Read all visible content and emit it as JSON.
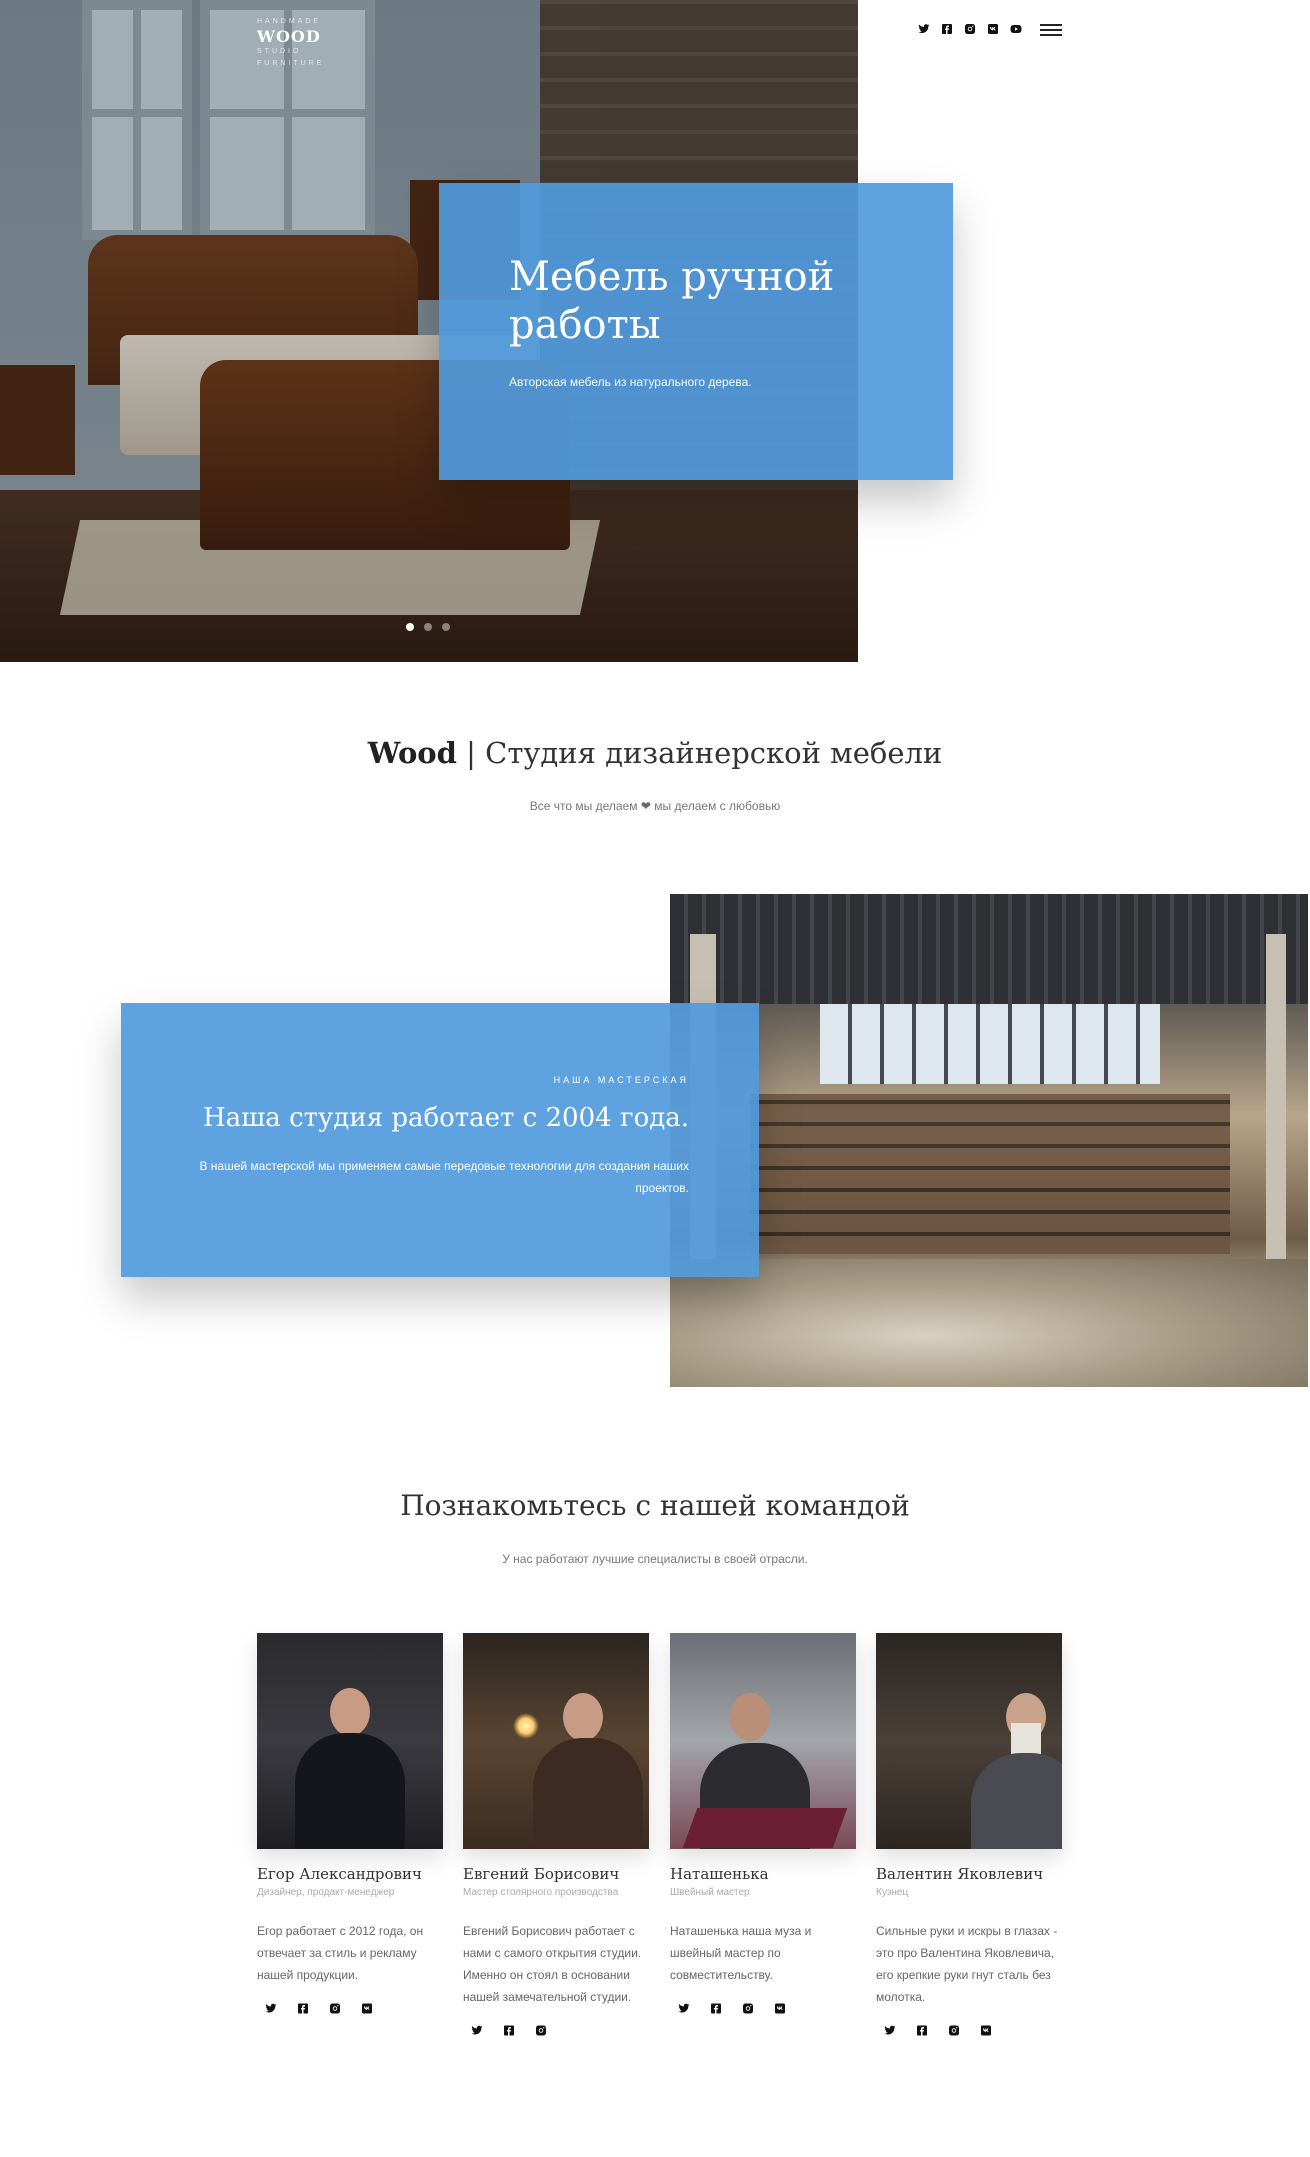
{
  "brand": {
    "top": "HANDMADE",
    "name": "WOOD",
    "bottom_1": "STUDIO",
    "bottom_2": "FURNITURE"
  },
  "header": {
    "social_icons": [
      "twitter-icon",
      "facebook-icon",
      "instagram-icon",
      "vk-icon",
      "youtube-icon"
    ],
    "menu_icon": "hamburger-menu-icon"
  },
  "hero": {
    "title": "Мебель ручной работы",
    "subtitle": "Авторская мебель из натурального дерева.",
    "slides": 3,
    "active_slide": 1,
    "accent_color": "#509ADD"
  },
  "intro": {
    "title_strong": "Wood",
    "title_separator": "|",
    "title_rest": "Студия дизайнерской мебели",
    "subtitle_before": "Все что мы делаем",
    "subtitle_icon": "heart-icon",
    "subtitle_after": "мы делаем с любовью"
  },
  "studio": {
    "kicker": "НАША МАСТЕРСКАЯ",
    "title": "Наша студия работает с 2004 года.",
    "text": "В нашей мастерской мы применяем самые передовые технологии для создания наших проектов."
  },
  "team": {
    "title": "Познакомьтесь с нашей командой",
    "subtitle": "У нас работают лучшие специалисты в своей отрасли.",
    "members": [
      {
        "name": "Егор Александрович",
        "role": "Дизайнер, продакт-менеджер",
        "bio": "Егор работает с 2012 года, он отвечает за стиль и рекламу нашей продукции.",
        "social": [
          "twitter-icon",
          "facebook-icon",
          "instagram-icon",
          "vk-icon"
        ]
      },
      {
        "name": "Евгений Борисович",
        "role": "Мастер столярного производства",
        "bio": "Евгений Борисович работает с нами с самого открытия студии. Именно он стоял в основании нашей замечательной студии.",
        "social": [
          "twitter-icon",
          "facebook-icon",
          "instagram-icon"
        ]
      },
      {
        "name": "Наташенька",
        "role": "Швейный мастер",
        "bio": "Наташенька наша муза и швейный мастер по совместительству.",
        "social": [
          "twitter-icon",
          "facebook-icon",
          "instagram-icon",
          "vk-icon"
        ]
      },
      {
        "name": "Валентин Яковлевич",
        "role": "Кузнец",
        "bio": "Сильные руки и искры в глазах - это про Валентина Яковлевича, его крепкие руки гнут сталь без молотка.",
        "social": [
          "twitter-icon",
          "facebook-icon",
          "instagram-icon",
          "vk-icon"
        ]
      }
    ]
  }
}
